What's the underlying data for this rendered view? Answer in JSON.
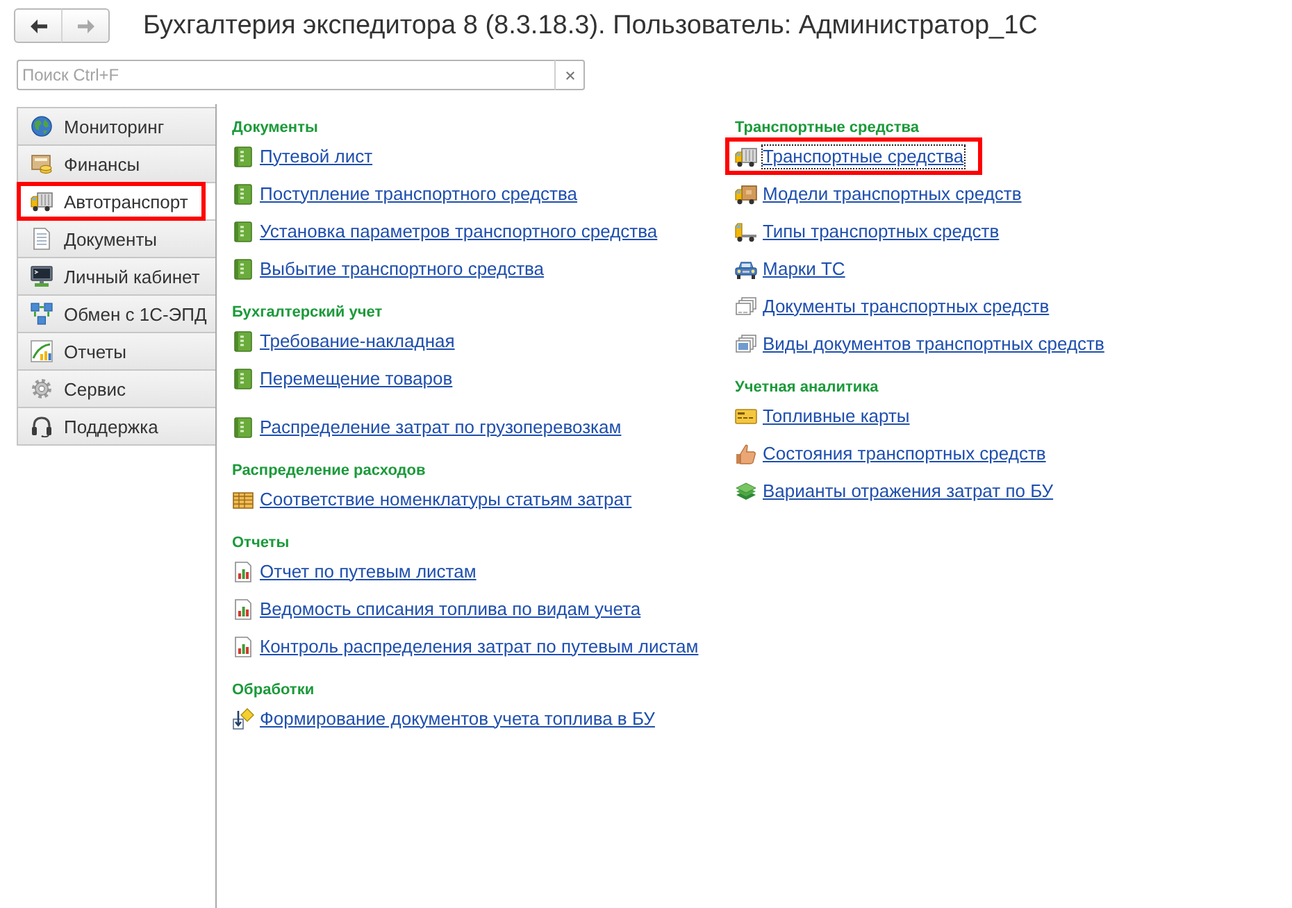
{
  "window": {
    "title": "Бухгалтерия экспедитора 8 (8.3.18.3). Пользователь: Администратор_1С"
  },
  "navigation": {
    "back": {
      "disabled": false
    },
    "forward": {
      "disabled": true
    }
  },
  "search": {
    "placeholder": "Поиск Ctrl+F"
  },
  "sidebar": {
    "items": [
      {
        "label": "Мониторинг",
        "kind": "globe",
        "selected": false,
        "highlighted": false
      },
      {
        "label": "Финансы",
        "kind": "coins",
        "selected": false,
        "highlighted": false
      },
      {
        "label": "Автотранспорт",
        "kind": "truck",
        "selected": true,
        "highlighted": true
      },
      {
        "label": "Документы",
        "kind": "document",
        "selected": false,
        "highlighted": false
      },
      {
        "label": "Личный кабинет",
        "kind": "monitor",
        "selected": false,
        "highlighted": false
      },
      {
        "label": "Обмен с 1С-ЭПД",
        "kind": "network",
        "selected": false,
        "highlighted": false
      },
      {
        "label": "Отчеты",
        "kind": "chart",
        "selected": false,
        "highlighted": false
      },
      {
        "label": "Сервис",
        "kind": "gear",
        "selected": false,
        "highlighted": false
      },
      {
        "label": "Поддержка",
        "kind": "headset",
        "selected": false,
        "highlighted": false
      }
    ]
  },
  "content": {
    "columns": [
      {
        "sections": [
          {
            "title": "Документы",
            "groups": [
              {
                "links": [
                  {
                    "text": "Путевой лист",
                    "kind": "ledger",
                    "focused": false,
                    "highlighted": false
                  },
                  {
                    "text": "Поступление транспортного средства",
                    "kind": "ledger",
                    "focused": false,
                    "highlighted": false
                  },
                  {
                    "text": "Установка параметров транспортного средства",
                    "kind": "ledger",
                    "focused": false,
                    "highlighted": false
                  },
                  {
                    "text": "Выбытие транспортного средства",
                    "kind": "ledger",
                    "focused": false,
                    "highlighted": false
                  }
                ]
              }
            ]
          },
          {
            "title": "Бухгалтерский учет",
            "groups": [
              {
                "links": [
                  {
                    "text": "Требование-накладная",
                    "kind": "ledger",
                    "focused": false,
                    "highlighted": false
                  },
                  {
                    "text": "Перемещение товаров",
                    "kind": "ledger",
                    "focused": false,
                    "highlighted": false
                  }
                ]
              },
              {
                "links": [
                  {
                    "text": "Распределение затрат по грузоперевозкам",
                    "kind": "ledger",
                    "focused": false,
                    "highlighted": false
                  }
                ]
              }
            ]
          },
          {
            "title": "Распределение расходов",
            "groups": [
              {
                "links": [
                  {
                    "text": "Соответствие номенклатуры статьям затрат",
                    "kind": "grid",
                    "focused": false,
                    "highlighted": false
                  }
                ]
              }
            ]
          },
          {
            "title": "Отчеты",
            "groups": [
              {
                "links": [
                  {
                    "text": "Отчет по путевым листам",
                    "kind": "report",
                    "focused": false,
                    "highlighted": false
                  },
                  {
                    "text": "Ведомость списания топлива по видам учета",
                    "kind": "report",
                    "focused": false,
                    "highlighted": false
                  },
                  {
                    "text": "Контроль распределения затрат по путевым листам",
                    "kind": "report",
                    "focused": false,
                    "highlighted": false
                  }
                ]
              }
            ]
          },
          {
            "title": "Обработки",
            "groups": [
              {
                "links": [
                  {
                    "text": "Формирование документов учета топлива в БУ",
                    "kind": "processing",
                    "focused": false,
                    "highlighted": false
                  }
                ]
              }
            ]
          }
        ]
      },
      {
        "sections": [
          {
            "title": "Транспортные средства",
            "groups": [
              {
                "links": [
                  {
                    "text": "Транспортные средства",
                    "kind": "truck",
                    "focused": true,
                    "highlighted": true
                  },
                  {
                    "text": "Модели транспортных средств",
                    "kind": "boxtruck",
                    "focused": false,
                    "highlighted": false
                  },
                  {
                    "text": "Типы транспортных средств",
                    "kind": "flatbed",
                    "focused": false,
                    "highlighted": false
                  },
                  {
                    "text": "Марки ТС",
                    "kind": "car",
                    "focused": false,
                    "highlighted": false
                  },
                  {
                    "text": "Документы транспортных средств",
                    "kind": "pages",
                    "focused": false,
                    "highlighted": false
                  },
                  {
                    "text": "Виды документов транспортных средств",
                    "kind": "cards",
                    "focused": false,
                    "highlighted": false
                  }
                ]
              }
            ]
          },
          {
            "title": "Учетная аналитика",
            "groups": [
              {
                "links": [
                  {
                    "text": "Топливные карты",
                    "kind": "fuelcard",
                    "focused": false,
                    "highlighted": false
                  },
                  {
                    "text": "Состояния транспортных средств",
                    "kind": "thumb",
                    "focused": false,
                    "highlighted": false
                  },
                  {
                    "text": "Варианты отражения затрат по БУ",
                    "kind": "layers",
                    "focused": false,
                    "highlighted": false
                  }
                ]
              }
            ]
          }
        ]
      }
    ]
  }
}
